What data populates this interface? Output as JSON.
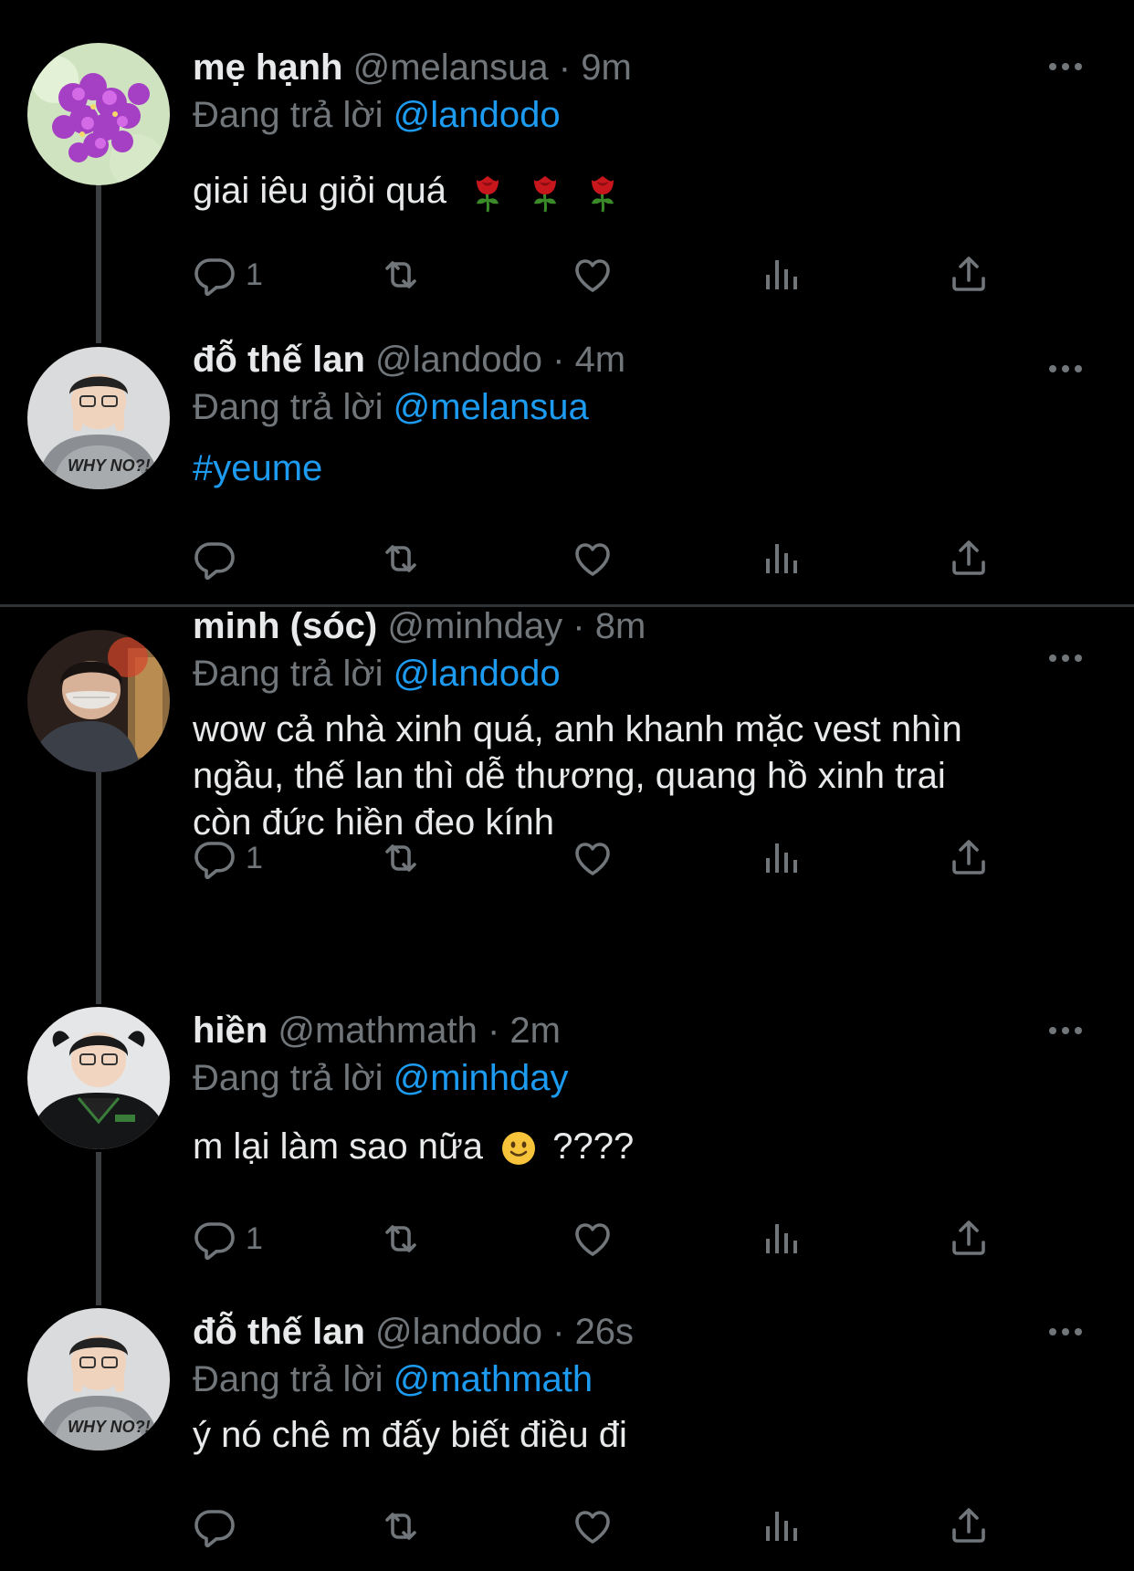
{
  "tweets": [
    {
      "name": "mẹ hạnh",
      "handle": "@melansua",
      "sep": "·",
      "time": "9m",
      "reply_prefix": "Đang trả lời",
      "reply_to": "@landodo",
      "text": "giai iêu giỏi quá",
      "reply_count": "1"
    },
    {
      "name": "đỗ thế lan",
      "handle": "@landodo",
      "sep": "·",
      "time": "4m",
      "reply_prefix": "Đang trả lời",
      "reply_to": "@melansua",
      "text": "#yeume",
      "reply_count": ""
    },
    {
      "name": "minh (sóc)",
      "handle": "@minhday",
      "sep": "·",
      "time": "8m",
      "reply_prefix": "Đang trả lời",
      "reply_to": "@landodo",
      "text_lines": [
        "wow cả nhà xinh quá, anh khanh mặc vest nhìn",
        "ngầu, thế lan thì dễ thương, quang hồ xinh trai",
        "còn đức hiền đeo kính"
      ],
      "reply_count": "1"
    },
    {
      "name": "hiền",
      "handle": "@mathmath",
      "sep": "·",
      "time": "2m",
      "reply_prefix": "Đang trả lời",
      "reply_to": "@minhday",
      "text_before_emoji": "m lại làm sao nữa",
      "text_after_emoji": "????",
      "reply_count": "1"
    },
    {
      "name": "đỗ thế lan",
      "handle": "@landodo",
      "sep": "·",
      "time": "26s",
      "reply_prefix": "Đang trả lời",
      "reply_to": "@mathmath",
      "text": "ý nó chê m đấy biết điều đi",
      "reply_count": ""
    }
  ],
  "colors": {
    "background": "#000000",
    "primary_text": "#e7e9ea",
    "secondary_text": "#71767b",
    "accent": "#1d9bf0",
    "divider": "#2f3336"
  },
  "icons": [
    "reply-icon",
    "retweet-icon",
    "like-icon",
    "views-icon",
    "share-icon",
    "more-icon",
    "rose-emoji",
    "smile-emoji"
  ]
}
